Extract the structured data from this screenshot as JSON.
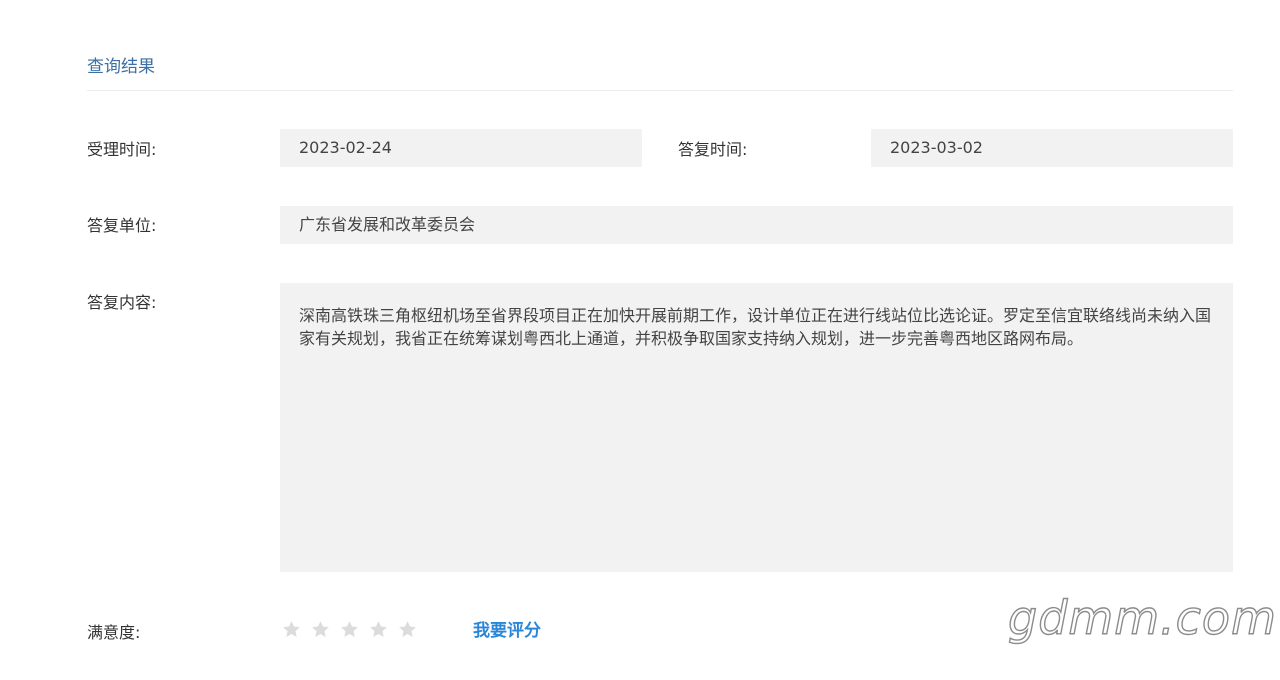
{
  "result": {
    "title": "查询结果",
    "accept_time_label": "受理时间:",
    "accept_time_value": "2023-02-24",
    "reply_time_label": "答复时间:",
    "reply_time_value": "2023-03-02",
    "reply_unit_label": "答复单位:",
    "reply_unit_value": "广东省发展和改革委员会",
    "reply_content_label": "答复内容:",
    "reply_content_value": "深南高铁珠三角枢纽机场至省界段项目正在加快开展前期工作，设计单位正在进行线站位比选论证。罗定至信宜联络线尚未纳入国家有关规划，我省正在统筹谋划粤西北上通道，并积极争取国家支持纳入规划，进一步完善粤西地区路网布局。",
    "satisfaction_label": "满意度:",
    "satisfaction_rating": 0,
    "satisfaction_max": 5,
    "rate_link": "我要评分"
  },
  "watermark": "gdmm.com",
  "colors": {
    "title": "#3b6fa6",
    "field_bg": "#f2f2f2",
    "link": "#2a86d8",
    "star_empty": "#dcdcdc"
  },
  "icons": {
    "star": "star-icon"
  }
}
